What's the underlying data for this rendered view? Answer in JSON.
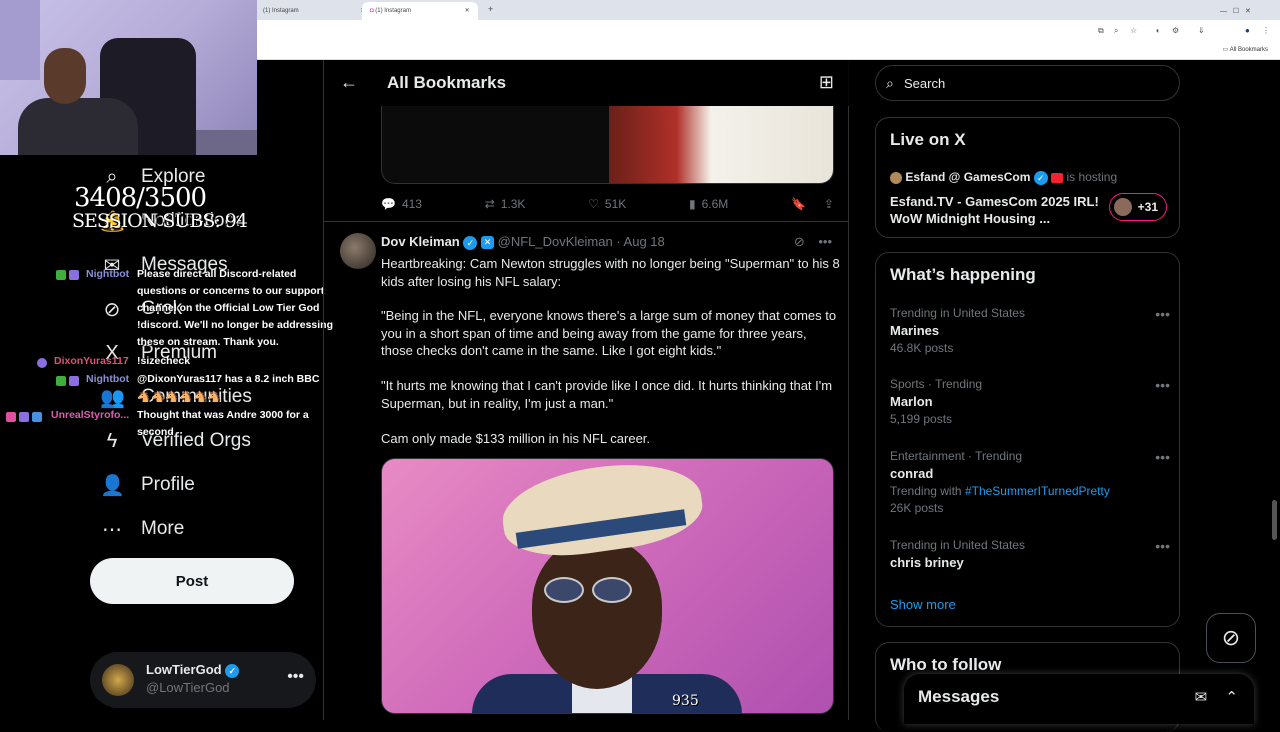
{
  "browser": {
    "tabs": [
      "(1) Instagram",
      "(1) Instagram"
    ],
    "new_tab": "+",
    "bookmarks_label": "All Bookmarks"
  },
  "overlay": {
    "sub_count": "3408/3500",
    "session_subs": "SESSION SUBS: 94"
  },
  "chat": [
    {
      "user": "Nightbot",
      "user_color": "#8a8fd6",
      "text_lines": [
        "Please direct all Discord-related",
        "questions or concerns to our support",
        "channel on the Official Low Tier God",
        "!discord. We'll no longer be addressing",
        "these on stream. Thank you."
      ]
    },
    {
      "user": "DixonYuras117",
      "user_color": "#e0517a",
      "text_lines": [
        "!sizecheck"
      ]
    },
    {
      "user": "Nightbot",
      "user_color": "#8a8fd6",
      "text_lines": [
        "@DixonYuras117 has a 8.2 inch BBC"
      ]
    },
    {
      "user": "UnrealStyrofo...",
      "user_color": "#d95fb0",
      "text_lines": [
        "Thought that was Andre 3000 for a",
        "second"
      ]
    }
  ],
  "sidebar": {
    "items": [
      {
        "label": "Explore",
        "icon": "search-icon",
        "glyph": "⌕"
      },
      {
        "label": "Notifications",
        "icon": "bell-icon",
        "glyph": "🔔"
      },
      {
        "label": "Messages",
        "icon": "envelope-icon",
        "glyph": "✉"
      },
      {
        "label": "Grok",
        "icon": "grok-icon",
        "glyph": "⊘"
      },
      {
        "label": "Premium",
        "icon": "x-logo-icon",
        "glyph": "X"
      },
      {
        "label": "Communities",
        "icon": "people-icon",
        "glyph": "👥"
      },
      {
        "label": "Verified Orgs",
        "icon": "lightning-icon",
        "glyph": "ϟ"
      },
      {
        "label": "Profile",
        "icon": "person-icon",
        "glyph": "👤"
      },
      {
        "label": "More",
        "icon": "more-circle-icon",
        "glyph": "⋯"
      }
    ],
    "post_label": "Post",
    "account": {
      "name": "LowTierGod",
      "handle": "@LowTierGod",
      "more": "•••"
    }
  },
  "main": {
    "title": "All Bookmarks",
    "prev_actions": {
      "replies": "413",
      "reposts": "1.3K",
      "likes": "51K",
      "views": "6.6M"
    },
    "tweet": {
      "name": "Dov Kleiman",
      "handle": "@NFL_DovKleiman",
      "date": "· Aug 18",
      "paragraphs": [
        "Heartbreaking: Cam Newton struggles with no longer being \"Superman\" to his 8 kids after losing his NFL salary:",
        "\"Being in the NFL, everyone knows there's a large sum of money that comes to you in a short span of time and being away from the game for three years, those checks don't came in the same. Like I got eight kids.\"",
        "\"It hurts me knowing that I can't provide like I once did. It hurts thinking that I'm Superman, but in reality, I'm just a man.\"",
        "Cam only made $133 million in his NFL career."
      ],
      "photo_overlay_text": "935"
    }
  },
  "right": {
    "search_placeholder": "Search",
    "live": {
      "title": "Live on X",
      "host_name": "Esfand @ GamesCom",
      "host_suffix": "is hosting",
      "stream_title": "Esfand.TV - GamesCom 2025 IRL! WoW Midnight Housing ...",
      "listeners": "+31"
    },
    "happening": {
      "title": "What’s happening",
      "trends": [
        {
          "meta": "Trending in United States",
          "name": "Marines",
          "sub": "46.8K posts"
        },
        {
          "meta": "Sports · Trending",
          "name": "Marlon",
          "sub": "5,199 posts"
        },
        {
          "meta": "Entertainment · Trending",
          "name": "conrad",
          "sub_prefix": "Trending with",
          "sub_link": "#TheSummerITurnedPretty",
          "sub2": "26K posts"
        },
        {
          "meta": "Trending in United States",
          "name": "chris briney"
        }
      ],
      "show_more": "Show more"
    },
    "who_to_follow": "Who to follow",
    "messages_title": "Messages"
  }
}
